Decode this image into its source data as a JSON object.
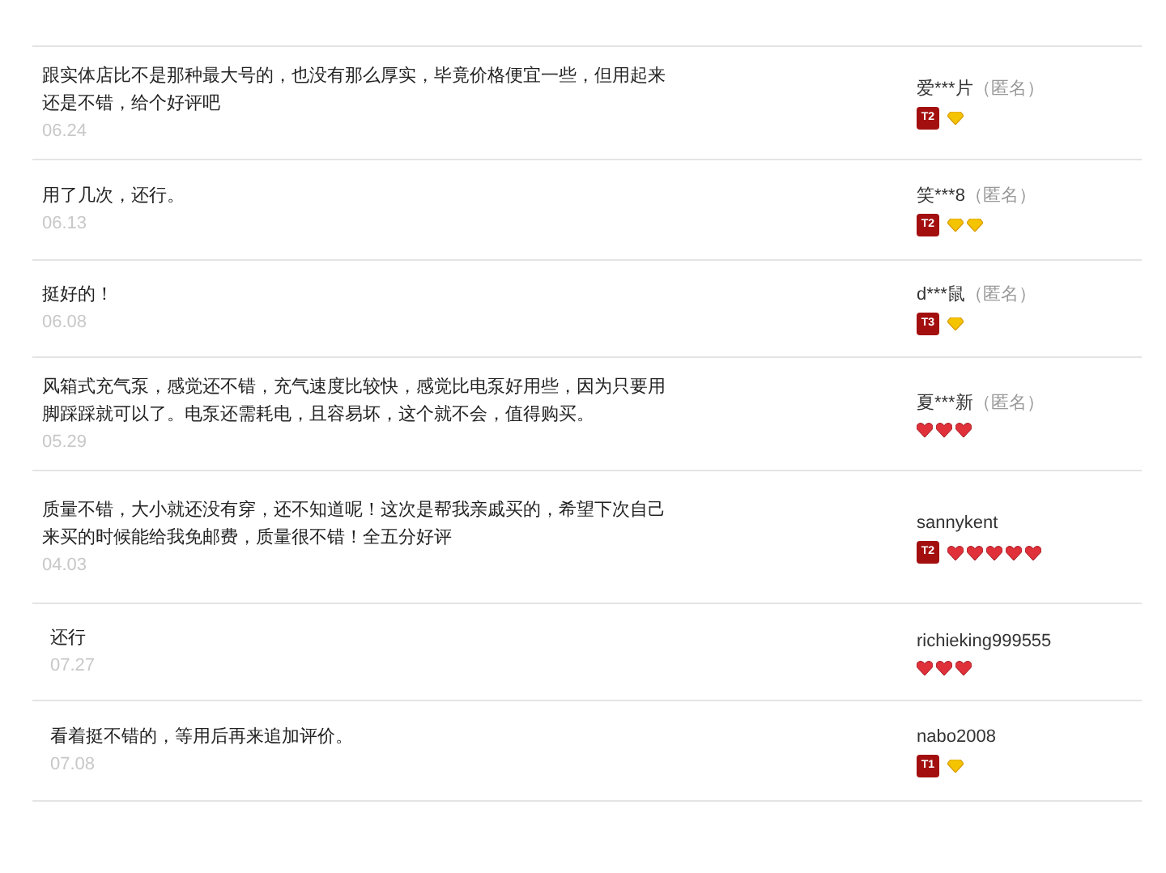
{
  "reviews": [
    {
      "comment": "跟实体店比不是那种最大号的，也没有那么厚实，毕竟价格便宜一些，但用起来还是不错，给个好评吧",
      "date": "06.24",
      "user": "爱***片",
      "anonymous": "（匿名）",
      "badge": "T2",
      "gems": [
        {
          "kind": "diamond"
        }
      ]
    },
    {
      "comment": "用了几次，还行。",
      "date": "06.13",
      "user": "笑***8",
      "anonymous": "（匿名）",
      "badge": "T2",
      "gems": [
        {
          "kind": "diamond"
        },
        {
          "kind": "diamond"
        }
      ]
    },
    {
      "comment": "挺好的！",
      "date": "06.08",
      "user": "d***鼠",
      "anonymous": "（匿名）",
      "badge": "T3",
      "gems": [
        {
          "kind": "diamond"
        }
      ]
    },
    {
      "comment": "风箱式充气泵，感觉还不错，充气速度比较快，感觉比电泵好用些，因为只要用脚踩踩就可以了。电泵还需耗电，且容易坏，这个就不会，值得购买。",
      "date": "05.29",
      "user": "夏***新",
      "anonymous": "（匿名）",
      "gems": [
        {
          "kind": "heart"
        },
        {
          "kind": "heart"
        },
        {
          "kind": "heart"
        }
      ]
    },
    {
      "comment": "质量不错，大小就还没有穿，还不知道呢！这次是帮我亲戚买的，希望下次自己来买的时候能给我免邮费，质量很不错！全五分好评",
      "date": "04.03",
      "user": "sannykent",
      "badge": "T2",
      "gems": [
        {
          "kind": "heart"
        },
        {
          "kind": "heart"
        },
        {
          "kind": "heart"
        },
        {
          "kind": "heart"
        },
        {
          "kind": "heart"
        }
      ]
    },
    {
      "comment": "还行",
      "date": "07.27",
      "user": "richieking999555",
      "gems": [
        {
          "kind": "heart"
        },
        {
          "kind": "heart"
        },
        {
          "kind": "heart"
        }
      ]
    },
    {
      "comment": "看着挺不错的，等用后再来追加评价。",
      "date": "07.08",
      "user": "nabo2008",
      "badge": "T1",
      "gems": [
        {
          "kind": "diamond"
        }
      ]
    }
  ]
}
